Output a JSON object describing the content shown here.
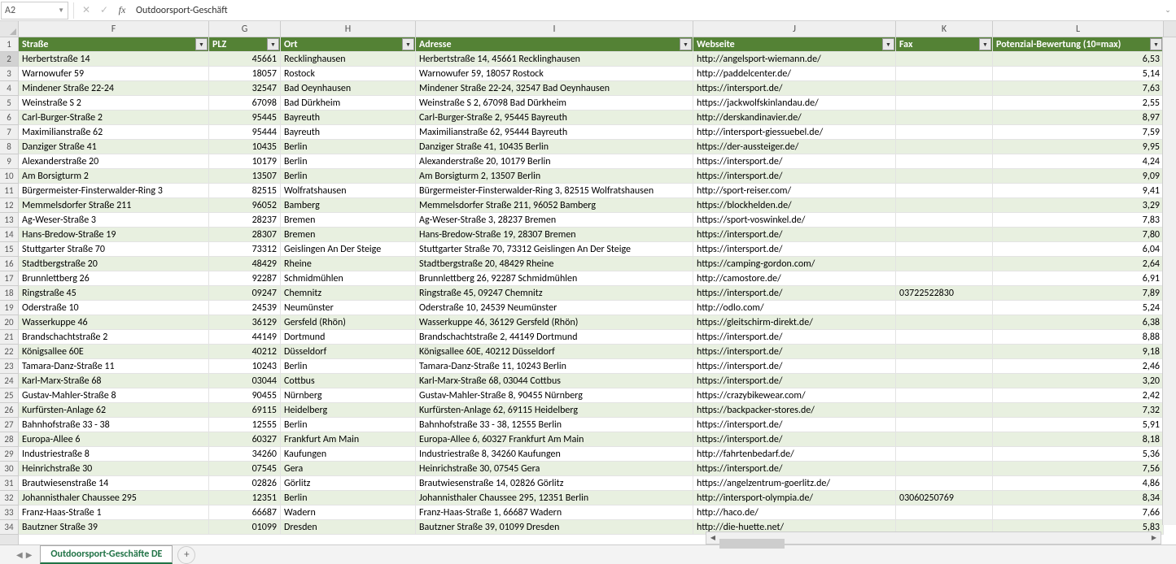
{
  "nameBox": "A2",
  "formulaValue": "Outdoorsport-Geschäft",
  "colLetters": [
    "F",
    "G",
    "H",
    "I",
    "J",
    "K",
    "L"
  ],
  "headers": {
    "F": "Straße",
    "G": "PLZ",
    "H": "Ort",
    "I": "Adresse",
    "J": "Webseite",
    "K": "Fax",
    "L": "Potenzial-Bewertung (10=max)"
  },
  "rows": [
    {
      "n": 2,
      "F": "Herbertstraße 14",
      "G": "45661",
      "H": "Recklinghausen",
      "I": "Herbertstraße 14, 45661 Recklinghausen",
      "J": "http://angelsport-wiemann.de/",
      "K": "",
      "L": "6,53"
    },
    {
      "n": 3,
      "F": "Warnowufer 59",
      "G": "18057",
      "H": "Rostock",
      "I": "Warnowufer 59, 18057 Rostock",
      "J": "http://paddelcenter.de/",
      "K": "",
      "L": "5,14"
    },
    {
      "n": 4,
      "F": "Mindener Straße 22-24",
      "G": "32547",
      "H": "Bad Oeynhausen",
      "I": "Mindener Straße 22-24, 32547 Bad Oeynhausen",
      "J": "https://intersport.de/",
      "K": "",
      "L": "7,63"
    },
    {
      "n": 5,
      "F": "Weinstraße S 2",
      "G": "67098",
      "H": "Bad Dürkheim",
      "I": "Weinstraße S 2, 67098 Bad Dürkheim",
      "J": "https://jackwolfskinlandau.de/",
      "K": "",
      "L": "2,55"
    },
    {
      "n": 6,
      "F": "Carl-Burger-Straße 2",
      "G": "95445",
      "H": "Bayreuth",
      "I": "Carl-Burger-Straße 2, 95445 Bayreuth",
      "J": "http://derskandinavier.de/",
      "K": "",
      "L": "8,97"
    },
    {
      "n": 7,
      "F": "Maximilianstraße 62",
      "G": "95444",
      "H": "Bayreuth",
      "I": "Maximilianstraße 62, 95444 Bayreuth",
      "J": "http://intersport-giessuebel.de/",
      "K": "",
      "L": "7,59"
    },
    {
      "n": 8,
      "F": "Danziger Straße 41",
      "G": "10435",
      "H": "Berlin",
      "I": "Danziger Straße 41, 10435 Berlin",
      "J": "https://der-aussteiger.de/",
      "K": "",
      "L": "9,95"
    },
    {
      "n": 9,
      "F": "Alexanderstraße 20",
      "G": "10179",
      "H": "Berlin",
      "I": "Alexanderstraße 20, 10179 Berlin",
      "J": "https://intersport.de/",
      "K": "",
      "L": "4,24"
    },
    {
      "n": 10,
      "F": "Am Borsigturm 2",
      "G": "13507",
      "H": "Berlin",
      "I": "Am Borsigturm 2, 13507 Berlin",
      "J": "https://intersport.de/",
      "K": "",
      "L": "9,09"
    },
    {
      "n": 11,
      "F": "Bürgermeister-Finsterwalder-Ring 3",
      "G": "82515",
      "H": "Wolfratshausen",
      "I": "Bürgermeister-Finsterwalder-Ring 3, 82515 Wolfratshausen",
      "J": "http://sport-reiser.com/",
      "K": "",
      "L": "9,41"
    },
    {
      "n": 12,
      "F": "Memmelsdorfer Straße 211",
      "G": "96052",
      "H": "Bamberg",
      "I": "Memmelsdorfer Straße 211, 96052 Bamberg",
      "J": "https://blockhelden.de/",
      "K": "",
      "L": "3,29"
    },
    {
      "n": 13,
      "F": "Ag-Weser-Straße 3",
      "G": "28237",
      "H": "Bremen",
      "I": "Ag-Weser-Straße 3, 28237 Bremen",
      "J": "https://sport-voswinkel.de/",
      "K": "",
      "L": "7,83"
    },
    {
      "n": 14,
      "F": "Hans-Bredow-Straße 19",
      "G": "28307",
      "H": "Bremen",
      "I": "Hans-Bredow-Straße 19, 28307 Bremen",
      "J": "https://intersport.de/",
      "K": "",
      "L": "7,80"
    },
    {
      "n": 15,
      "F": "Stuttgarter Straße 70",
      "G": "73312",
      "H": "Geislingen An Der Steige",
      "I": "Stuttgarter Straße 70, 73312 Geislingen An Der Steige",
      "J": "https://intersport.de/",
      "K": "",
      "L": "6,04"
    },
    {
      "n": 16,
      "F": "Stadtbergstraße 20",
      "G": "48429",
      "H": "Rheine",
      "I": "Stadtbergstraße 20, 48429 Rheine",
      "J": "https://camping-gordon.com/",
      "K": "",
      "L": "2,64"
    },
    {
      "n": 17,
      "F": "Brunnlettberg 26",
      "G": "92287",
      "H": "Schmidmühlen",
      "I": "Brunnlettberg 26, 92287 Schmidmühlen",
      "J": "http://camostore.de/",
      "K": "",
      "L": "6,91"
    },
    {
      "n": 18,
      "F": "Ringstraße 45",
      "G": "09247",
      "H": "Chemnitz",
      "I": "Ringstraße 45, 09247 Chemnitz",
      "J": "https://intersport.de/",
      "K": "03722522830",
      "L": "7,89"
    },
    {
      "n": 19,
      "F": "Oderstraße 10",
      "G": "24539",
      "H": "Neumünster",
      "I": "Oderstraße 10, 24539 Neumünster",
      "J": "http://odlo.com/",
      "K": "",
      "L": "5,24"
    },
    {
      "n": 20,
      "F": "Wasserkuppe 46",
      "G": "36129",
      "H": "Gersfeld (Rhön)",
      "I": "Wasserkuppe 46, 36129 Gersfeld (Rhön)",
      "J": "https://gleitschirm-direkt.de/",
      "K": "",
      "L": "6,38"
    },
    {
      "n": 21,
      "F": "Brandschachtstraße 2",
      "G": "44149",
      "H": "Dortmund",
      "I": "Brandschachtstraße 2, 44149 Dortmund",
      "J": "https://intersport.de/",
      "K": "",
      "L": "8,88"
    },
    {
      "n": 22,
      "F": "Königsallee 60E",
      "G": "40212",
      "H": "Düsseldorf",
      "I": "Königsallee 60E, 40212 Düsseldorf",
      "J": "https://intersport.de/",
      "K": "",
      "L": "9,18"
    },
    {
      "n": 23,
      "F": "Tamara-Danz-Straße 11",
      "G": "10243",
      "H": "Berlin",
      "I": "Tamara-Danz-Straße 11, 10243 Berlin",
      "J": "https://intersport.de/",
      "K": "",
      "L": "2,46"
    },
    {
      "n": 24,
      "F": "Karl-Marx-Straße 68",
      "G": "03044",
      "H": "Cottbus",
      "I": "Karl-Marx-Straße 68, 03044 Cottbus",
      "J": "https://intersport.de/",
      "K": "",
      "L": "3,20"
    },
    {
      "n": 25,
      "F": "Gustav-Mahler-Straße 8",
      "G": "90455",
      "H": "Nürnberg",
      "I": "Gustav-Mahler-Straße 8, 90455 Nürnberg",
      "J": "https://crazybikewear.com/",
      "K": "",
      "L": "2,42"
    },
    {
      "n": 26,
      "F": "Kurfürsten-Anlage 62",
      "G": "69115",
      "H": "Heidelberg",
      "I": "Kurfürsten-Anlage 62, 69115 Heidelberg",
      "J": "https://backpacker-stores.de/",
      "K": "",
      "L": "7,32"
    },
    {
      "n": 27,
      "F": "Bahnhofstraße 33 - 38",
      "G": "12555",
      "H": "Berlin",
      "I": "Bahnhofstraße 33 - 38, 12555 Berlin",
      "J": "https://intersport.de/",
      "K": "",
      "L": "5,91"
    },
    {
      "n": 28,
      "F": "Europa-Allee 6",
      "G": "60327",
      "H": "Frankfurt Am Main",
      "I": "Europa-Allee 6, 60327 Frankfurt Am Main",
      "J": "https://intersport.de/",
      "K": "",
      "L": "8,18"
    },
    {
      "n": 29,
      "F": "Industriestraße 8",
      "G": "34260",
      "H": "Kaufungen",
      "I": "Industriestraße 8, 34260 Kaufungen",
      "J": "http://fahrtenbedarf.de/",
      "K": "",
      "L": "5,36"
    },
    {
      "n": 30,
      "F": "Heinrichstraße 30",
      "G": "07545",
      "H": "Gera",
      "I": "Heinrichstraße 30, 07545 Gera",
      "J": "https://intersport.de/",
      "K": "",
      "L": "7,56"
    },
    {
      "n": 31,
      "F": "Brautwiesenstraße 14",
      "G": "02826",
      "H": "Görlitz",
      "I": "Brautwiesenstraße 14, 02826 Görlitz",
      "J": "https://angelzentrum-goerlitz.de/",
      "K": "",
      "L": "4,86"
    },
    {
      "n": 32,
      "F": "Johannisthaler Chaussee 295",
      "G": "12351",
      "H": "Berlin",
      "I": "Johannisthaler Chaussee 295, 12351 Berlin",
      "J": "http://intersport-olympia.de/",
      "K": "03060250769",
      "L": "8,34"
    },
    {
      "n": 33,
      "F": "Franz-Haas-Straße 1",
      "G": "66687",
      "H": "Wadern",
      "I": "Franz-Haas-Straße 1, 66687 Wadern",
      "J": "http://haco.de/",
      "K": "",
      "L": "7,66"
    },
    {
      "n": 34,
      "F": "Bautzner Straße 39",
      "G": "01099",
      "H": "Dresden",
      "I": "Bautzner Straße 39, 01099 Dresden",
      "J": "http://die-huette.net/",
      "K": "",
      "L": "5,83"
    }
  ],
  "sheetTab": "Outdoorsport-Geschäfte DE"
}
